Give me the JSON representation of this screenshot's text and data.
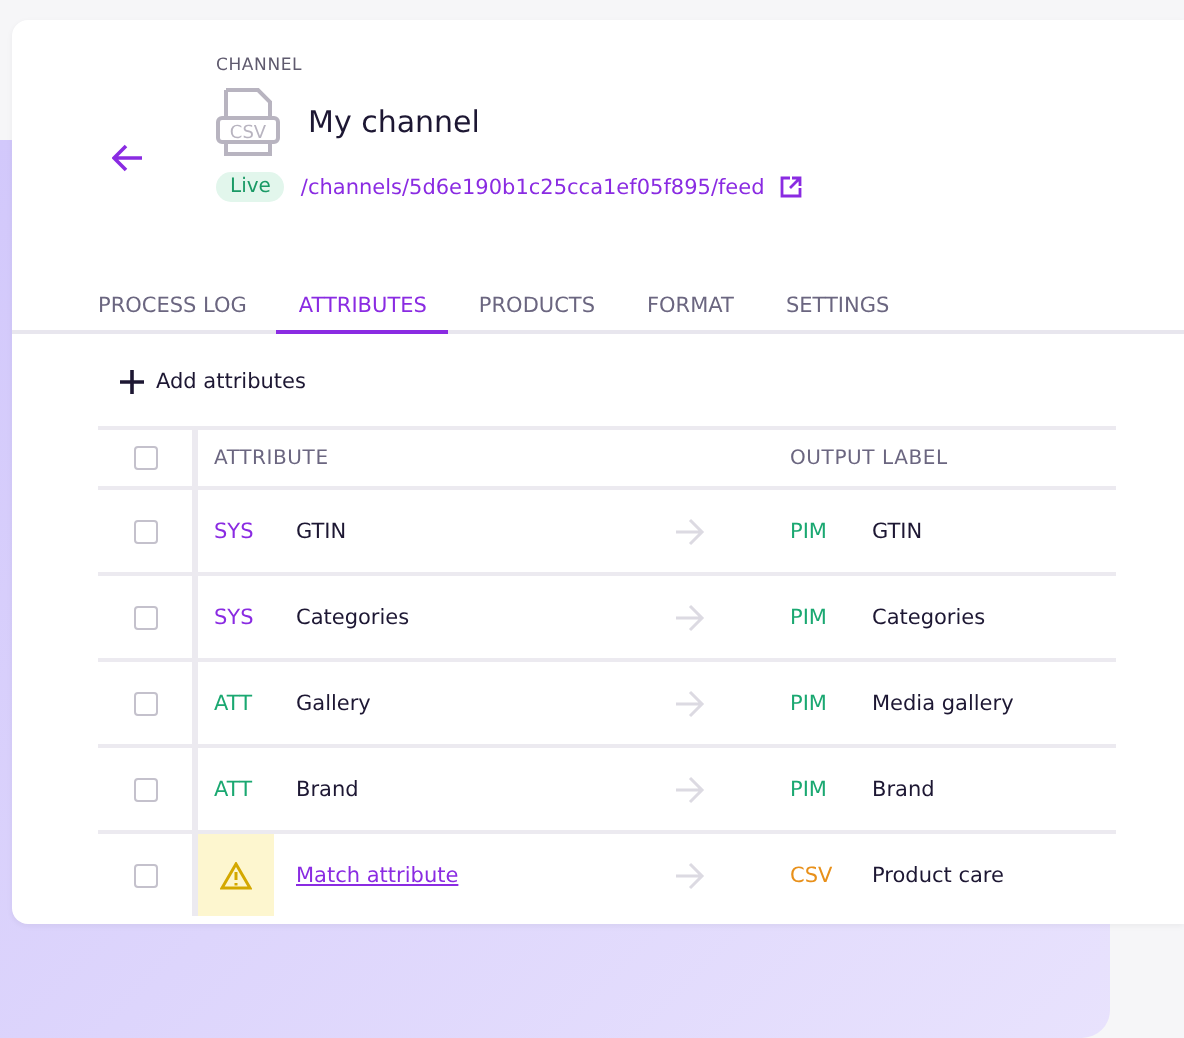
{
  "header": {
    "eyebrow": "CHANNEL",
    "icon_label": "CSV",
    "title": "My channel",
    "status": "Live",
    "feed_link": "/channels/5d6e190b1c25cca1ef05f895/feed"
  },
  "tabs": [
    {
      "label": "PROCESS LOG",
      "selected": false
    },
    {
      "label": "ATTRIBUTES",
      "selected": true
    },
    {
      "label": "PRODUCTS",
      "selected": false
    },
    {
      "label": "FORMAT",
      "selected": false
    },
    {
      "label": "SETTINGS",
      "selected": false
    }
  ],
  "add_button": "Add attributes",
  "table": {
    "select_all_checked": false,
    "columns": [
      "ATTRIBUTE",
      "OUTPUT LABEL"
    ],
    "rows": [
      {
        "kind": "mapped",
        "checked": false,
        "source": {
          "text": "SYS",
          "color": "#8a2be2"
        },
        "attribute": "GTIN",
        "target": {
          "text": "PIM",
          "color": "#1aa871"
        },
        "label": "GTIN"
      },
      {
        "kind": "mapped",
        "checked": false,
        "source": {
          "text": "SYS",
          "color": "#8a2be2"
        },
        "attribute": "Categories",
        "target": {
          "text": "PIM",
          "color": "#1aa871"
        },
        "label": "Categories"
      },
      {
        "kind": "mapped",
        "checked": false,
        "source": {
          "text": "ATT",
          "color": "#1aa871"
        },
        "attribute": "Gallery",
        "target": {
          "text": "PIM",
          "color": "#1aa871"
        },
        "label": "Media gallery"
      },
      {
        "kind": "mapped",
        "checked": false,
        "source": {
          "text": "ATT",
          "color": "#1aa871"
        },
        "attribute": "Brand",
        "target": {
          "text": "PIM",
          "color": "#1aa871"
        },
        "label": "Brand"
      },
      {
        "kind": "unmatched",
        "checked": false,
        "attribute": "Match attribute",
        "target": {
          "text": "CSV",
          "color": "#e8901a"
        },
        "label": "Product care"
      }
    ]
  }
}
